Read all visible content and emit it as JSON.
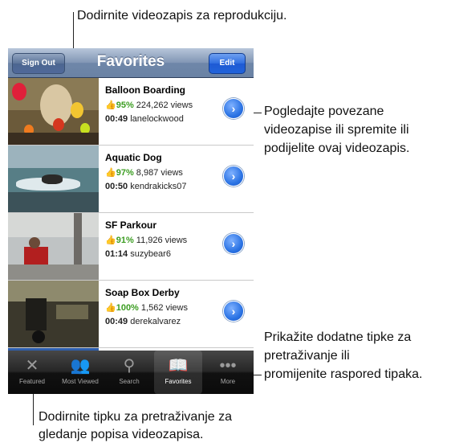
{
  "app": {
    "title": "Favorites",
    "sign_out": "Sign Out",
    "edit": "Edit"
  },
  "videos": [
    {
      "title": "Balloon Boarding",
      "rating": "95%",
      "views": "224,262 views",
      "duration": "00:49",
      "user": "lanelockwood",
      "thumb_icon": "thumbs-up-icon"
    },
    {
      "title": "Aquatic Dog",
      "rating": "97%",
      "views": "8,987 views",
      "duration": "00:50",
      "user": "kendrakicks07",
      "thumb_icon": "thumbs-up-icon"
    },
    {
      "title": "SF Parkour",
      "rating": "91%",
      "views": "11,926 views",
      "duration": "01:14",
      "user": "suzybear6",
      "thumb_icon": "thumbs-up-icon"
    },
    {
      "title": "Soap Box Derby",
      "rating": "100%",
      "views": "1,562 views",
      "duration": "00:49",
      "user": "derekalvarez",
      "thumb_icon": "thumbs-up-icon"
    }
  ],
  "tabs": [
    {
      "label": "Featured",
      "icon": "featured-icon"
    },
    {
      "label": "Most Viewed",
      "icon": "most-viewed-icon"
    },
    {
      "label": "Search",
      "icon": "search-icon"
    },
    {
      "label": "Favorites",
      "icon": "book-icon",
      "active": true
    },
    {
      "label": "More",
      "icon": "more-icon"
    }
  ],
  "callouts": {
    "top": "Dodirnite videozapis za reprodukciju.",
    "right_1": "Pogledajte povezane",
    "right_2": "videozapise ili spremite ili",
    "right_3": "podijelite ovaj videozapis.",
    "more_1": "Prikažite dodatne tipke za",
    "more_2": "pretraživanje ili",
    "more_3": "promijenite raspored tipaka.",
    "bottom_1": "Dodirnite tipku za pretraživanje za",
    "bottom_2": "gledanje popisa videozapisa."
  }
}
